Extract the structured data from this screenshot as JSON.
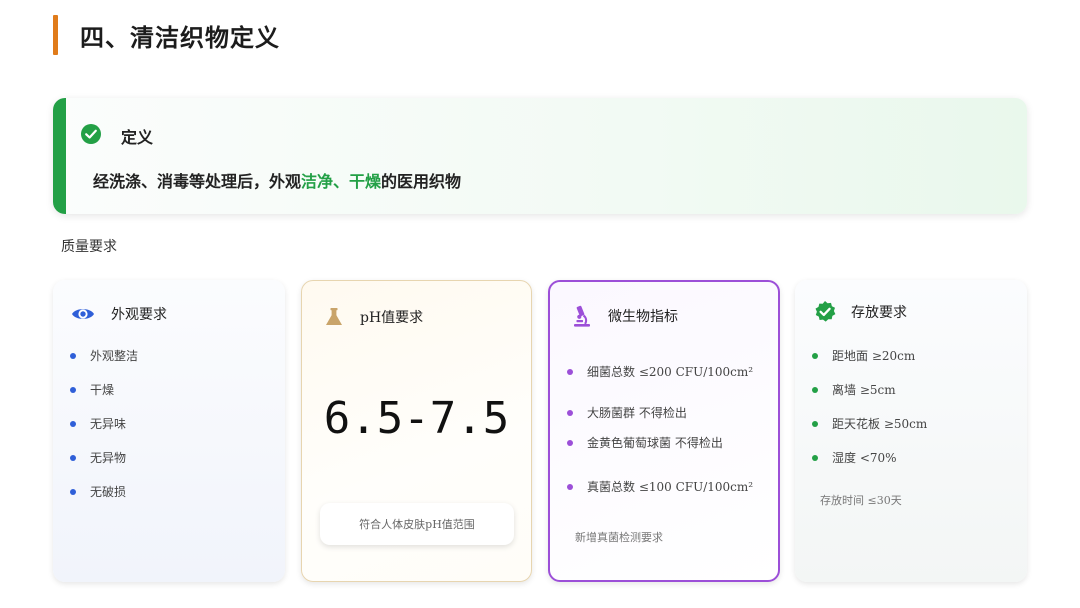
{
  "page": {
    "title": "四、清洁织物定义"
  },
  "definition": {
    "heading": "定义",
    "text_before": "经洗涤、消毒等处理后，外观",
    "highlight": "洁净、干燥",
    "text_after": "的医用织物"
  },
  "quality_label": "质量要求",
  "cards": [
    {
      "title": "外观要求",
      "icon": "eye-icon",
      "items": [
        "外观整洁",
        "干燥",
        "无异味",
        "无异物",
        "无破损"
      ]
    },
    {
      "title": "pH值要求",
      "icon": "flask-icon",
      "value": "6.5-7.5",
      "note": "符合人体皮肤pH值范围"
    },
    {
      "title": "微生物指标",
      "icon": "microscope-icon",
      "items": [
        "细菌总数 ≤200 CFU/100cm²",
        "大肠菌群 不得检出",
        "金黄色葡萄球菌 不得检出",
        "真菌总数 ≤100 CFU/100cm²"
      ],
      "note": "新增真菌检测要求"
    },
    {
      "title": "存放要求",
      "icon": "badge-check-icon",
      "items": [
        "距地面 ≥20cm",
        "离墙 ≥5cm",
        "距天花板 ≥50cm",
        "湿度 <70%"
      ],
      "note": "存放时间 ≤30天"
    }
  ],
  "colors": {
    "title_accent": "#e07b1a",
    "green": "#23a046",
    "blue": "#2f5fd8",
    "purple": "#9c4fd8",
    "gold": "#c9a46a"
  }
}
